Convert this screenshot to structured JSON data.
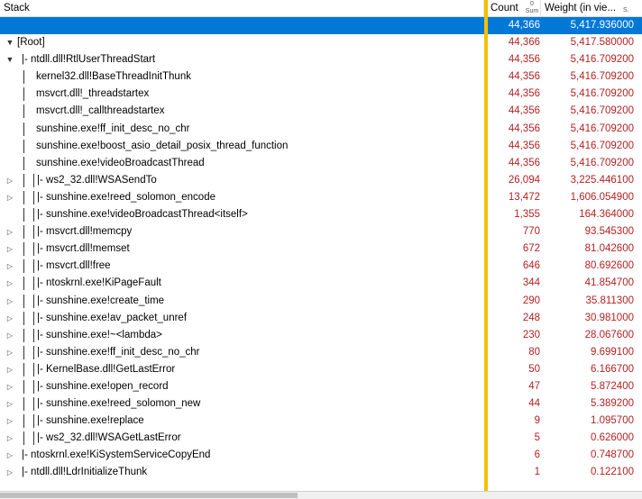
{
  "header": {
    "stack": "Stack",
    "count": "Count",
    "count_sum": "Sum",
    "count_sort": "0",
    "weight": "Weight (in vie...",
    "weight_sort": "S."
  },
  "rows": [
    {
      "label": "",
      "count": "44,366",
      "weight": "5,417.936000",
      "selected": true,
      "depth": 0,
      "expander": "none",
      "bars": 0
    },
    {
      "label": "[Root]",
      "count": "44,366",
      "weight": "5,417.580000",
      "depth": 0,
      "expander": "open",
      "bars": 0
    },
    {
      "label": "|- ntdll.dll!RtlUserThreadStart",
      "count": "44,356",
      "weight": "5,416.709200",
      "depth": 1,
      "expander": "open",
      "bars": 0
    },
    {
      "label": "kernel32.dll!BaseThreadInitThunk",
      "count": "44,356",
      "weight": "5,416.709200",
      "depth": 2,
      "expander": "none",
      "bars": 1
    },
    {
      "label": "msvcrt.dll!_threadstartex",
      "count": "44,356",
      "weight": "5,416.709200",
      "depth": 2,
      "expander": "none",
      "bars": 1
    },
    {
      "label": "msvcrt.dll!_callthreadstartex",
      "count": "44,356",
      "weight": "5,416.709200",
      "depth": 2,
      "expander": "none",
      "bars": 1
    },
    {
      "label": "sunshine.exe!ff_init_desc_no_chr",
      "count": "44,356",
      "weight": "5,416.709200",
      "depth": 2,
      "expander": "none",
      "bars": 1
    },
    {
      "label": "sunshine.exe!boost_asio_detail_posix_thread_function",
      "count": "44,356",
      "weight": "5,416.709200",
      "depth": 2,
      "expander": "none",
      "bars": 1
    },
    {
      "label": "sunshine.exe!videoBroadcastThread",
      "count": "44,356",
      "weight": "5,416.709200",
      "depth": 2,
      "expander": "none",
      "bars": 1
    },
    {
      "label": "|- ws2_32.dll!WSASendTo",
      "count": "26,094",
      "weight": "3,225.446100",
      "depth": 3,
      "expander": "closed",
      "bars": 2
    },
    {
      "label": "|- sunshine.exe!reed_solomon_encode",
      "count": "13,472",
      "weight": "1,606.054900",
      "depth": 3,
      "expander": "closed",
      "bars": 2
    },
    {
      "label": "|- sunshine.exe!videoBroadcastThread<itself>",
      "count": "1,355",
      "weight": "164.364000",
      "depth": 3,
      "expander": "none",
      "bars": 2
    },
    {
      "label": "|- msvcrt.dll!memcpy",
      "count": "770",
      "weight": "93.545300",
      "depth": 3,
      "expander": "closed",
      "bars": 2
    },
    {
      "label": "|- msvcrt.dll!memset",
      "count": "672",
      "weight": "81.042600",
      "depth": 3,
      "expander": "closed",
      "bars": 2
    },
    {
      "label": "|- msvcrt.dll!free",
      "count": "646",
      "weight": "80.692600",
      "depth": 3,
      "expander": "closed",
      "bars": 2
    },
    {
      "label": "|- ntoskrnl.exe!KiPageFault",
      "count": "344",
      "weight": "41.854700",
      "depth": 3,
      "expander": "closed",
      "bars": 2
    },
    {
      "label": "|- sunshine.exe!create_time",
      "count": "290",
      "weight": "35.811300",
      "depth": 3,
      "expander": "closed",
      "bars": 2
    },
    {
      "label": "|- sunshine.exe!av_packet_unref",
      "count": "248",
      "weight": "30.981000",
      "depth": 3,
      "expander": "closed",
      "bars": 2
    },
    {
      "label": "|- sunshine.exe!~<lambda>",
      "count": "230",
      "weight": "28.067600",
      "depth": 3,
      "expander": "closed",
      "bars": 2
    },
    {
      "label": "|- sunshine.exe!ff_init_desc_no_chr",
      "count": "80",
      "weight": "9.699100",
      "depth": 3,
      "expander": "closed",
      "bars": 2
    },
    {
      "label": "|- KernelBase.dll!GetLastError",
      "count": "50",
      "weight": "6.166700",
      "depth": 3,
      "expander": "closed",
      "bars": 2
    },
    {
      "label": "|- sunshine.exe!open_record",
      "count": "47",
      "weight": "5.872400",
      "depth": 3,
      "expander": "closed",
      "bars": 2
    },
    {
      "label": "|- sunshine.exe!reed_solomon_new",
      "count": "44",
      "weight": "5.389200",
      "depth": 3,
      "expander": "closed",
      "bars": 2
    },
    {
      "label": "|- sunshine.exe!replace",
      "count": "9",
      "weight": "1.095700",
      "depth": 3,
      "expander": "closed",
      "bars": 2
    },
    {
      "label": "|- ws2_32.dll!WSAGetLastError",
      "count": "5",
      "weight": "0.626000",
      "depth": 3,
      "expander": "closed",
      "bars": 2
    },
    {
      "label": "|- ntoskrnl.exe!KiSystemServiceCopyEnd",
      "count": "6",
      "weight": "0.748700",
      "depth": 1,
      "expander": "closed",
      "bars": 0
    },
    {
      "label": "|- ntdll.dll!LdrInitializeThunk",
      "count": "1",
      "weight": "0.122100",
      "depth": 1,
      "expander": "closed",
      "bars": 0
    }
  ],
  "icons": {
    "expanded": "triangle-down-icon",
    "collapsed": "triangle-right-icon"
  },
  "colors": {
    "selection": "#0078d7",
    "value_text": "#b22222",
    "sort_column_bar": "#f2c100"
  }
}
